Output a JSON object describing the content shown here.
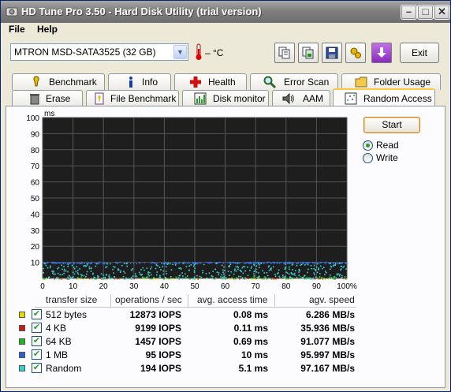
{
  "window": {
    "title": "HD Tune Pro 3.50 - Hard Disk Utility (trial version)"
  },
  "titlebar_buttons": [
    "minimize",
    "maximize",
    "close"
  ],
  "menu": [
    {
      "label": "File"
    },
    {
      "label": "Help"
    }
  ],
  "toolbar": {
    "drive": "MTRON MSD-SATA3525 (32 GB)",
    "temperature": "– °C",
    "icon_buttons": [
      "copy-info-icon",
      "copy-screenshot-icon",
      "save-icon",
      "options-icon",
      "download-icon"
    ],
    "exit_label": "Exit"
  },
  "tabs_top": [
    {
      "label": "Benchmark",
      "icon": "benchmark-icon"
    },
    {
      "label": "Info",
      "icon": "info-icon"
    },
    {
      "label": "Health",
      "icon": "health-icon"
    },
    {
      "label": "Error Scan",
      "icon": "error-scan-icon"
    },
    {
      "label": "Folder Usage",
      "icon": "folder-icon"
    }
  ],
  "tabs_bottom": [
    {
      "label": "Erase",
      "icon": "erase-icon"
    },
    {
      "label": "File Benchmark",
      "icon": "file-benchmark-icon"
    },
    {
      "label": "Disk monitor",
      "icon": "disk-monitor-icon"
    },
    {
      "label": "AAM",
      "icon": "speaker-icon"
    },
    {
      "label": "Random Access",
      "icon": "random-access-icon",
      "active": true
    }
  ],
  "controls": {
    "start_label": "Start",
    "mode_options": [
      {
        "label": "Read",
        "selected": true
      },
      {
        "label": "Write",
        "selected": false
      }
    ]
  },
  "chart_data": {
    "type": "scatter",
    "y_unit": "ms",
    "ylim": [
      0,
      100
    ],
    "y_ticks": [
      100,
      90,
      80,
      70,
      60,
      50,
      40,
      30,
      20,
      10
    ],
    "xlim": [
      0,
      100
    ],
    "x_ticks": [
      "0",
      "10",
      "20",
      "30",
      "40",
      "50",
      "60",
      "70",
      "80",
      "90",
      "100%"
    ],
    "grid": true,
    "background": "#1e1e1e",
    "series": [
      {
        "name": "512 bytes",
        "color": "#f0e000",
        "band": [
          0,
          0.3
        ]
      },
      {
        "name": "4 KB",
        "color": "#e02020",
        "band": [
          0,
          0.4
        ]
      },
      {
        "name": "64 KB",
        "color": "#20c020",
        "band": [
          0,
          1.5
        ]
      },
      {
        "name": "1 MB",
        "color": "#3070e0",
        "band": [
          9.5,
          10.5
        ]
      },
      {
        "name": "Random",
        "color": "#40d8d8",
        "band": [
          0,
          10
        ]
      }
    ]
  },
  "results": {
    "headers": [
      "transfer size",
      "operations / sec",
      "avg. access time",
      "agv. speed"
    ],
    "rows": [
      {
        "size": "512 bytes",
        "iops": "12873 IOPS",
        "time": "0.08 ms",
        "speed": "6.286 MB/s",
        "color": "#e8d800"
      },
      {
        "size": "4 KB",
        "iops": "9199 IOPS",
        "time": "0.11 ms",
        "speed": "35.936 MB/s",
        "color": "#d01818"
      },
      {
        "size": "64 KB",
        "iops": "1457 IOPS",
        "time": "0.69 ms",
        "speed": "91.077 MB/s",
        "color": "#18b818"
      },
      {
        "size": "1 MB",
        "iops": "95 IOPS",
        "time": "10 ms",
        "speed": "95.997 MB/s",
        "color": "#2860d8"
      },
      {
        "size": "Random",
        "iops": "194 IOPS",
        "time": "5.1 ms",
        "speed": "97.167 MB/s",
        "color": "#30d0d0"
      }
    ]
  }
}
